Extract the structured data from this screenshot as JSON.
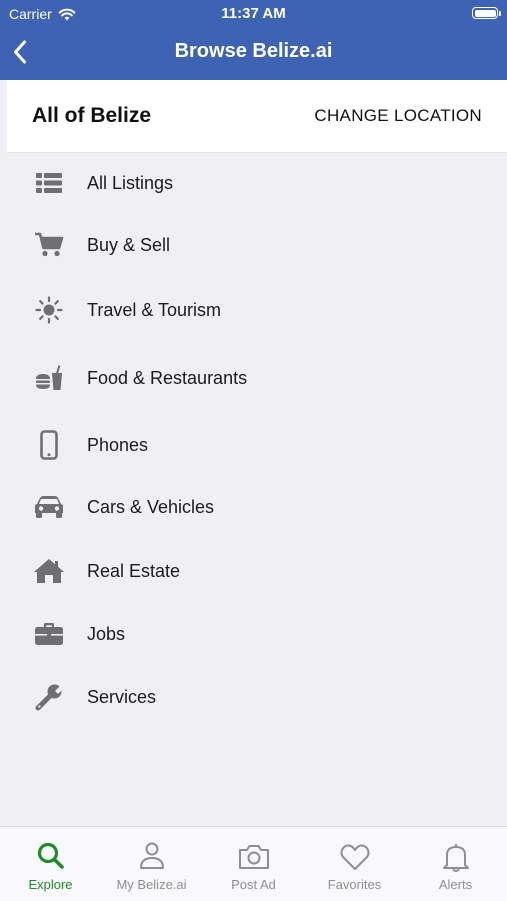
{
  "status_bar": {
    "carrier": "Carrier",
    "time": "11:37 AM"
  },
  "nav": {
    "title": "Browse Belize.ai",
    "back_icon": "chevron-left-icon"
  },
  "location": {
    "name": "All of Belize",
    "change_label": "CHANGE LOCATION"
  },
  "categories": [
    {
      "label": "All Listings",
      "icon": "list-icon"
    },
    {
      "label": "Buy & Sell",
      "icon": "cart-icon"
    },
    {
      "label": "Travel & Tourism",
      "icon": "sun-icon"
    },
    {
      "label": "Food & Restaurants",
      "icon": "food-drink-icon"
    },
    {
      "label": "Phones",
      "icon": "phone-icon"
    },
    {
      "label": "Cars & Vehicles",
      "icon": "car-icon"
    },
    {
      "label": "Real Estate",
      "icon": "house-icon"
    },
    {
      "label": "Jobs",
      "icon": "briefcase-icon"
    },
    {
      "label": "Services",
      "icon": "wrench-icon"
    }
  ],
  "tabs": [
    {
      "label": "Explore",
      "icon": "search-icon",
      "active": true
    },
    {
      "label": "My Belize.ai",
      "icon": "person-icon",
      "active": false
    },
    {
      "label": "Post Ad",
      "icon": "camera-icon",
      "active": false
    },
    {
      "label": "Favorites",
      "icon": "heart-icon",
      "active": false
    },
    {
      "label": "Alerts",
      "icon": "bell-icon",
      "active": false
    }
  ],
  "colors": {
    "nav_bar": "#3f63b3",
    "accent_active": "#1f8a2e",
    "icon_gray": "#6e6e73",
    "background": "#efeff4"
  }
}
